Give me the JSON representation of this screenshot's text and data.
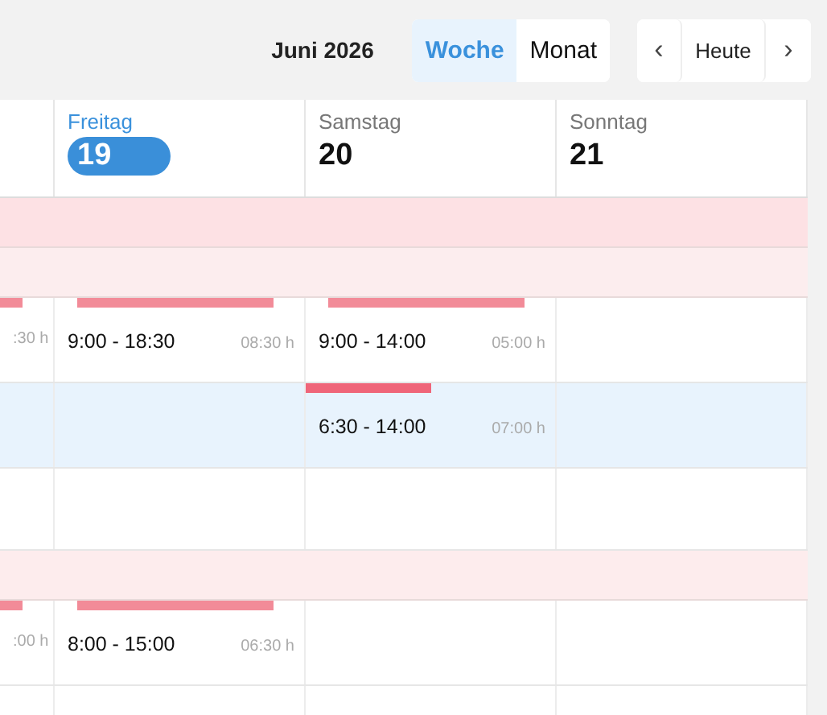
{
  "toolbar": {
    "title": "Juni 2026",
    "views": [
      {
        "label": "Woche",
        "selected": true
      },
      {
        "label": "Monat",
        "selected": false
      }
    ],
    "nav": [
      {
        "kind": "prev",
        "label": "‹"
      },
      {
        "kind": "today",
        "label": "Heute"
      },
      {
        "kind": "next",
        "label": "›"
      }
    ]
  },
  "days": [
    {
      "kind": "partial"
    },
    {
      "kind": "day",
      "name": "Freitag",
      "date": "19",
      "today": true
    },
    {
      "kind": "day",
      "name": "Samstag",
      "date": "20",
      "today": false
    },
    {
      "kind": "day",
      "name": "Sonntag",
      "date": "21",
      "today": false
    }
  ],
  "rows": [
    {
      "kind": "band",
      "color": "#fde1e4"
    },
    {
      "kind": "band",
      "color": "#fcedee"
    },
    {
      "kind": "shifts",
      "highlighted": false,
      "cells": [
        {
          "kind": "shift",
          "duration": ":30 h"
        },
        {
          "kind": "shift",
          "time": "9:00 - 18:30",
          "duration": "08:30 h"
        },
        {
          "kind": "shift",
          "time": "9:00 - 14:00",
          "duration": "05:00 h"
        },
        {
          "kind": "empty"
        }
      ]
    },
    {
      "kind": "shifts",
      "highlighted": true,
      "cells": [
        {
          "kind": "empty"
        },
        {
          "kind": "empty"
        },
        {
          "kind": "shift",
          "time": "6:30 - 14:00",
          "duration": "07:00 h"
        },
        {
          "kind": "empty"
        }
      ]
    },
    {
      "kind": "empty"
    },
    {
      "kind": "band",
      "color": "#fdeced"
    },
    {
      "kind": "shifts",
      "highlighted": false,
      "cells": [
        {
          "kind": "shift",
          "duration": ":00 h"
        },
        {
          "kind": "shift",
          "time": "8:00 - 15:00",
          "duration": "06:30 h"
        },
        {
          "kind": "empty"
        },
        {
          "kind": "empty"
        }
      ]
    },
    {
      "kind": "empty"
    }
  ]
}
